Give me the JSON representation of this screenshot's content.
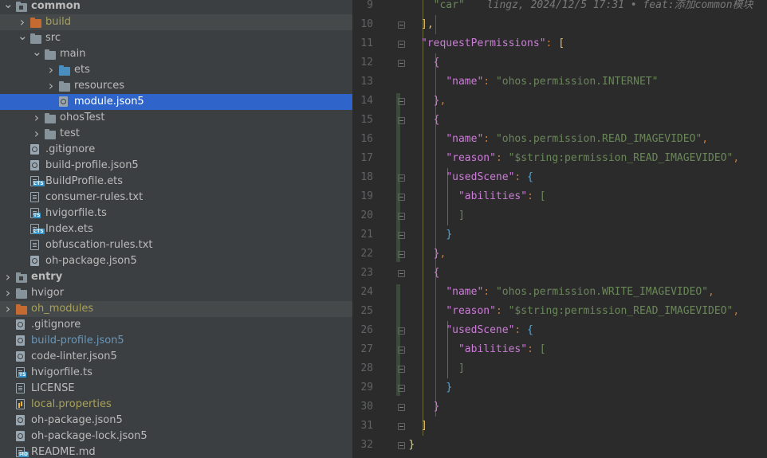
{
  "project_tree": {
    "rows": [
      {
        "label": "common",
        "depth": 0,
        "arrow": "down",
        "icon": "module-folder-icon",
        "bold": true,
        "state": "normal"
      },
      {
        "label": "build",
        "depth": 1,
        "arrow": "right",
        "icon": "orange-folder-icon",
        "color": "olive",
        "state": "hl"
      },
      {
        "label": "src",
        "depth": 1,
        "arrow": "down",
        "icon": "folder-icon",
        "state": "normal"
      },
      {
        "label": "main",
        "depth": 2,
        "arrow": "down",
        "icon": "folder-icon",
        "state": "normal"
      },
      {
        "label": "ets",
        "depth": 3,
        "arrow": "right",
        "icon": "blue-folder-icon",
        "state": "normal"
      },
      {
        "label": "resources",
        "depth": 3,
        "arrow": "right",
        "icon": "folder-icon",
        "state": "normal"
      },
      {
        "label": "module.json5",
        "depth": 3,
        "arrow": "",
        "icon": "json-gear-icon",
        "state": "sel"
      },
      {
        "label": "ohosTest",
        "depth": 2,
        "arrow": "right",
        "icon": "folder-icon",
        "state": "normal"
      },
      {
        "label": "test",
        "depth": 2,
        "arrow": "right",
        "icon": "folder-icon",
        "state": "normal"
      },
      {
        "label": ".gitignore",
        "depth": 1,
        "arrow": "",
        "icon": "gear-file-icon",
        "state": "normal"
      },
      {
        "label": "build-profile.json5",
        "depth": 1,
        "arrow": "",
        "icon": "json-gear-icon",
        "state": "normal"
      },
      {
        "label": "BuildProfile.ets",
        "depth": 1,
        "arrow": "",
        "icon": "ets-file-icon",
        "state": "normal"
      },
      {
        "label": "consumer-rules.txt",
        "depth": 1,
        "arrow": "",
        "icon": "text-file-icon",
        "state": "normal"
      },
      {
        "label": "hvigorfile.ts",
        "depth": 1,
        "arrow": "",
        "icon": "ts-file-icon",
        "state": "normal"
      },
      {
        "label": "Index.ets",
        "depth": 1,
        "arrow": "",
        "icon": "ets-file-icon",
        "state": "normal"
      },
      {
        "label": "obfuscation-rules.txt",
        "depth": 1,
        "arrow": "",
        "icon": "text-file-icon",
        "state": "normal"
      },
      {
        "label": "oh-package.json5",
        "depth": 1,
        "arrow": "",
        "icon": "json-gear-icon",
        "state": "normal"
      },
      {
        "label": "entry",
        "depth": 0,
        "arrow": "right",
        "icon": "module-folder-icon",
        "bold": true,
        "state": "normal"
      },
      {
        "label": "hvigor",
        "depth": 0,
        "arrow": "right",
        "icon": "folder-icon",
        "state": "normal"
      },
      {
        "label": "oh_modules",
        "depth": 0,
        "arrow": "right",
        "icon": "orange-folder-icon",
        "color": "olive",
        "state": "hl"
      },
      {
        "label": ".gitignore",
        "depth": 0,
        "arrow": "",
        "icon": "gear-file-icon",
        "state": "normal"
      },
      {
        "label": "build-profile.json5",
        "depth": 0,
        "arrow": "",
        "icon": "json-gear-icon",
        "color": "blue",
        "state": "normal"
      },
      {
        "label": "code-linter.json5",
        "depth": 0,
        "arrow": "",
        "icon": "json-gear-icon",
        "state": "normal"
      },
      {
        "label": "hvigorfile.ts",
        "depth": 0,
        "arrow": "",
        "icon": "ts-file-icon",
        "state": "normal"
      },
      {
        "label": "LICENSE",
        "depth": 0,
        "arrow": "",
        "icon": "text-file-icon",
        "state": "normal"
      },
      {
        "label": "local.properties",
        "depth": 0,
        "arrow": "",
        "icon": "properties-file-icon",
        "color": "olive",
        "state": "normal"
      },
      {
        "label": "oh-package.json5",
        "depth": 0,
        "arrow": "",
        "icon": "json-gear-icon",
        "state": "normal"
      },
      {
        "label": "oh-package-lock.json5",
        "depth": 0,
        "arrow": "",
        "icon": "json-gear-icon",
        "state": "normal"
      },
      {
        "label": "README.md",
        "depth": 0,
        "arrow": "",
        "icon": "md-file-icon",
        "state": "normal"
      }
    ]
  },
  "editor": {
    "first_line": 9,
    "blame": "lingz, 2024/12/5 17:31 • feat:添加common模块",
    "lines": [
      {
        "no": "9",
        "tokens": [
          [
            "s",
            "\"car\""
          ]
        ],
        "indent": 2,
        "blame": true,
        "fold": false
      },
      {
        "no": "10",
        "tokens": [
          [
            "y",
            "],"
          ]
        ],
        "indent": 1,
        "fold": true
      },
      {
        "no": "11",
        "tokens": [
          [
            "k",
            "\"requestPermissions\""
          ],
          [
            "p",
            ": "
          ],
          [
            "y",
            "["
          ]
        ],
        "indent": 1,
        "fold": true
      },
      {
        "no": "12",
        "tokens": [
          [
            "pu",
            "{"
          ]
        ],
        "indent": 2,
        "fold": true
      },
      {
        "no": "13",
        "tokens": [
          [
            "k",
            "\"name\""
          ],
          [
            "p",
            ": "
          ],
          [
            "s",
            "\"ohos.permission.INTERNET\""
          ]
        ],
        "indent": 3,
        "fold": false
      },
      {
        "no": "14",
        "tokens": [
          [
            "pu",
            "}"
          ],
          [
            "p",
            ","
          ]
        ],
        "indent": 2,
        "fold": true
      },
      {
        "no": "15",
        "tokens": [
          [
            "pu",
            "{"
          ]
        ],
        "indent": 2,
        "fold": true
      },
      {
        "no": "16",
        "tokens": [
          [
            "k",
            "\"name\""
          ],
          [
            "p",
            ": "
          ],
          [
            "s",
            "\"ohos.permission.READ_IMAGEVIDEO\""
          ],
          [
            "p",
            ","
          ]
        ],
        "indent": 3,
        "fold": false
      },
      {
        "no": "17",
        "tokens": [
          [
            "k",
            "\"reason\""
          ],
          [
            "p",
            ": "
          ],
          [
            "s",
            "\"$string:permission_READ_IMAGEVIDEO\""
          ],
          [
            "p",
            ","
          ]
        ],
        "indent": 3,
        "fold": false
      },
      {
        "no": "18",
        "tokens": [
          [
            "k",
            "\"usedScene\""
          ],
          [
            "p",
            ": "
          ],
          [
            "bl",
            "{"
          ]
        ],
        "indent": 3,
        "fold": true
      },
      {
        "no": "19",
        "tokens": [
          [
            "k",
            "\"abilities\""
          ],
          [
            "p",
            ": "
          ],
          [
            "s",
            "["
          ]
        ],
        "indent": 4,
        "fold": true
      },
      {
        "no": "20",
        "tokens": [
          [
            "s",
            "]"
          ]
        ],
        "indent": 4,
        "fold": true
      },
      {
        "no": "21",
        "tokens": [
          [
            "bl",
            "}"
          ]
        ],
        "indent": 3,
        "fold": true
      },
      {
        "no": "22",
        "tokens": [
          [
            "pu",
            "}"
          ],
          [
            "p",
            ","
          ]
        ],
        "indent": 2,
        "fold": true
      },
      {
        "no": "23",
        "tokens": [
          [
            "pu",
            "{"
          ]
        ],
        "indent": 2,
        "fold": true
      },
      {
        "no": "24",
        "tokens": [
          [
            "k",
            "\"name\""
          ],
          [
            "p",
            ": "
          ],
          [
            "s",
            "\"ohos.permission.WRITE_IMAGEVIDEO\""
          ],
          [
            "p",
            ","
          ]
        ],
        "indent": 3,
        "fold": false
      },
      {
        "no": "25",
        "tokens": [
          [
            "k",
            "\"reason\""
          ],
          [
            "p",
            ": "
          ],
          [
            "s",
            "\"$string:permission_READ_IMAGEVIDEO\""
          ],
          [
            "p",
            ","
          ]
        ],
        "indent": 3,
        "fold": false
      },
      {
        "no": "26",
        "tokens": [
          [
            "k",
            "\"usedScene\""
          ],
          [
            "p",
            ": "
          ],
          [
            "bl",
            "{"
          ]
        ],
        "indent": 3,
        "fold": true
      },
      {
        "no": "27",
        "tokens": [
          [
            "k",
            "\"abilities\""
          ],
          [
            "p",
            ": "
          ],
          [
            "s",
            "["
          ]
        ],
        "indent": 4,
        "fold": true
      },
      {
        "no": "28",
        "tokens": [
          [
            "s",
            "]"
          ]
        ],
        "indent": 4,
        "fold": true
      },
      {
        "no": "29",
        "tokens": [
          [
            "bl",
            "}"
          ]
        ],
        "indent": 3,
        "fold": true
      },
      {
        "no": "30",
        "tokens": [
          [
            "pu",
            "}"
          ]
        ],
        "indent": 2,
        "fold": true
      },
      {
        "no": "31",
        "tokens": [
          [
            "y",
            "]"
          ]
        ],
        "indent": 1,
        "fold": true
      },
      {
        "no": "32",
        "tokens": [
          [
            "b",
            "}"
          ]
        ],
        "indent": 0,
        "fold": true
      }
    ]
  }
}
